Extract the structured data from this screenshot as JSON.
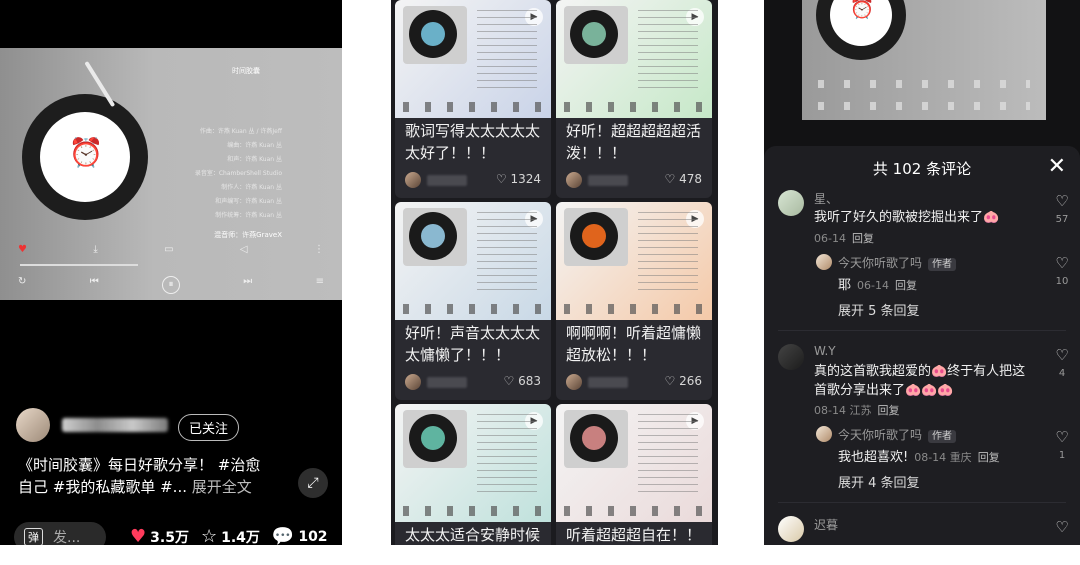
{
  "panel1": {
    "song_title": "时间胶囊",
    "follow_label": "已关注",
    "caption_line1": "《时间胶囊》每日好歌分享！ #治愈",
    "caption_line2": "自己 #我的私藏歌单 #...",
    "caption_more": "展开全文",
    "danmu_label": "弹",
    "comment_input": "发...",
    "likes": "3.5万",
    "favorites": "1.4万",
    "comments": "102",
    "lyric_highlight": "混音师：许燕GraveX",
    "icons": [
      "record-icon",
      "alarm-clock-icon",
      "heart-icon",
      "star-icon",
      "comment-icon",
      "fullscreen-icon"
    ]
  },
  "panel2": {
    "cards": [
      {
        "title": "歌词写得太太太太太太好了！！！",
        "likes": "1324",
        "art": "#6ab0c8",
        "bg": "#c9d3e8"
      },
      {
        "title": "好听！超超超超超活泼！！！",
        "likes": "478",
        "art": "#79b29a",
        "bg": "#c6e8c8"
      },
      {
        "title": "好听！声音太太太太太慵懒了！！！",
        "likes": "683",
        "art": "#8ab8d0",
        "bg": "#c8d8e6"
      },
      {
        "title": "啊啊啊！听着超慵懒超放松！！！",
        "likes": "266",
        "art": "#e0641c",
        "bg": "#f4c9a8"
      },
      {
        "title": "太太太适合安静时候",
        "likes": "",
        "art": "#5fb4a0",
        "bg": "#bfe1dc"
      },
      {
        "title": "听着超超超自在！！",
        "likes": "",
        "art": "#c8807f",
        "bg": "#eadada"
      }
    ]
  },
  "panel3": {
    "header": "共 102 条评论",
    "comments": [
      {
        "name": "星、",
        "text": "我听了好久的歌被挖掘出来了🐽",
        "date": "06-14",
        "reply": "回复",
        "likes": "57",
        "sub": {
          "name": "今天你听歌了吗",
          "tag": "作者",
          "text": "耶",
          "date": "06-14",
          "reply": "回复",
          "likes": "10"
        },
        "expand": "展开 5 条回复"
      },
      {
        "name": "W.Y",
        "text_line1": "真的这首歌我超爱的🐽终于有人把这",
        "text_line2": "首歌分享出来了🐽🐽🐽",
        "date": "08-14",
        "loc": "江苏",
        "reply": "回复",
        "likes": "4",
        "sub": {
          "name": "今天你听歌了吗",
          "tag": "作者",
          "text": "我也超喜欢!",
          "date": "08-14",
          "loc": "重庆",
          "reply": "回复",
          "likes": "1"
        },
        "expand": "展开 4 条回复"
      },
      {
        "name": "迟暮",
        "text": "",
        "date": "",
        "likes": ""
      }
    ]
  }
}
